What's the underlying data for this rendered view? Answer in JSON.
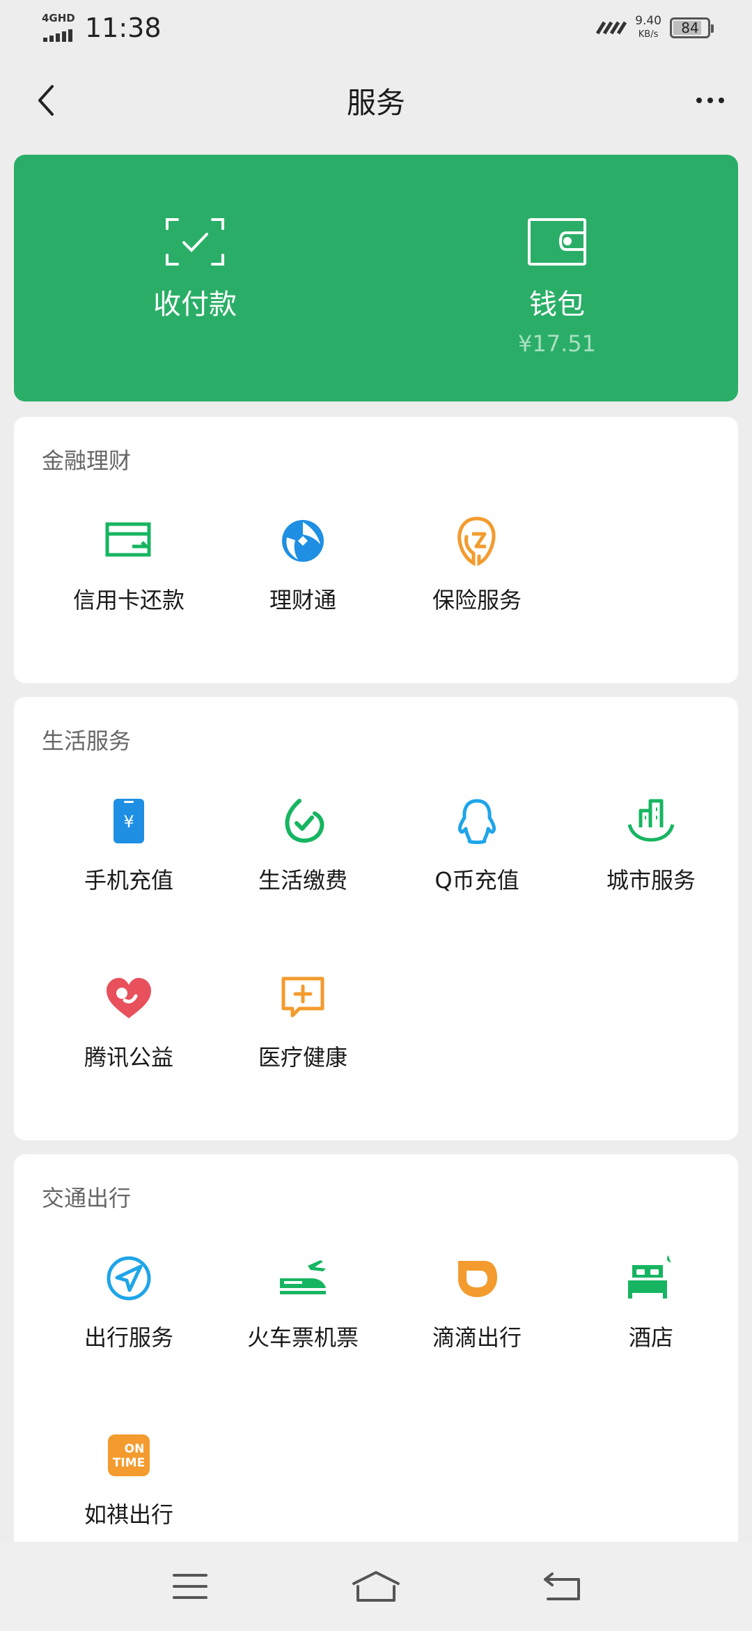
{
  "status_bar": {
    "network": "4GHD",
    "time": "11:38",
    "speed_value": "9.40",
    "speed_unit": "KB/s",
    "battery": "84",
    "battery_level": 0.84
  },
  "nav": {
    "title": "服务"
  },
  "top_card": {
    "color": "#2aae67",
    "pay_label": "收付款",
    "wallet_label": "钱包",
    "wallet_balance": "¥17.51"
  },
  "sections": [
    {
      "title": "金融理财",
      "items": [
        {
          "label": "信用卡还款",
          "icon": "credit-card-icon",
          "color": "#17b561"
        },
        {
          "label": "理财通",
          "icon": "licaitong-icon",
          "color": "#1e8fe3"
        },
        {
          "label": "保险服务",
          "icon": "insurance-icon",
          "color": "#f39b2e"
        }
      ]
    },
    {
      "title": "生活服务",
      "items": [
        {
          "label": "手机充值",
          "icon": "mobile-recharge-icon",
          "color": "#1e8fe3"
        },
        {
          "label": "生活缴费",
          "icon": "utility-payment-icon",
          "color": "#17b561"
        },
        {
          "label": "Q币充值",
          "icon": "qq-penguin-icon",
          "color": "#1ea5e8"
        },
        {
          "label": "城市服务",
          "icon": "city-service-icon",
          "color": "#17b561"
        },
        {
          "label": "腾讯公益",
          "icon": "charity-heart-icon",
          "color": "#e8505b"
        },
        {
          "label": "医疗健康",
          "icon": "medical-icon",
          "color": "#f39b2e"
        }
      ]
    },
    {
      "title": "交通出行",
      "items": [
        {
          "label": "出行服务",
          "icon": "navigation-icon",
          "color": "#1ea5e8"
        },
        {
          "label": "火车票机票",
          "icon": "train-plane-icon",
          "color": "#17b561"
        },
        {
          "label": "滴滴出行",
          "icon": "didi-icon",
          "color": "#f39b2e"
        },
        {
          "label": "酒店",
          "icon": "hotel-bed-icon",
          "color": "#17b561"
        },
        {
          "label": "如祺出行",
          "icon": "ontime-icon",
          "color": "#f39b2e",
          "badge_line1": "ON",
          "badge_line2": "TIME"
        }
      ]
    }
  ]
}
